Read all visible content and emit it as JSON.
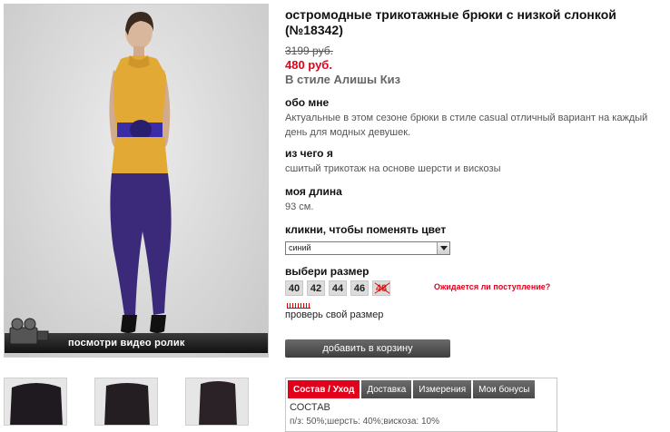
{
  "product": {
    "title": "остромодные трикотажные брюки с низкой слонкой (№18342)",
    "old_price": "3199 руб.",
    "new_price": "480 руб.",
    "style": "В стиле Алишы Киз"
  },
  "video": {
    "label": "посмотри видео ролик"
  },
  "sections": {
    "about_heading": "обо мне",
    "about_text": "Актуальные в этом сезоне брюки в стиле casual отличный вариант на каждый день для модных девушек.",
    "material_heading": "из чего я",
    "material_text": "сшитый трикотаж на основе шерсти и вискозы",
    "length_heading": "моя длина",
    "length_text": "93 см.",
    "color_heading": "кликни, чтобы поменять цвет",
    "size_heading": "выбери размер"
  },
  "color_select": {
    "value": "синий"
  },
  "sizes": [
    "40",
    "42",
    "44",
    "46",
    "48"
  ],
  "waiting_link": "Ожидается ли поступление?",
  "check_size": "проверь свой размер",
  "cart_button": "добавить в корзину",
  "tabs": [
    "Состав / Уход",
    "Доставка",
    "Измерения",
    "Мои бонусы"
  ],
  "composition": {
    "heading": "СОСТАВ",
    "text": "п/з: 50%;шерсть: 40%;вискоза: 10%"
  },
  "colors": {
    "accent_red": "#e3001b",
    "button_gray": "#4a4a4a"
  }
}
